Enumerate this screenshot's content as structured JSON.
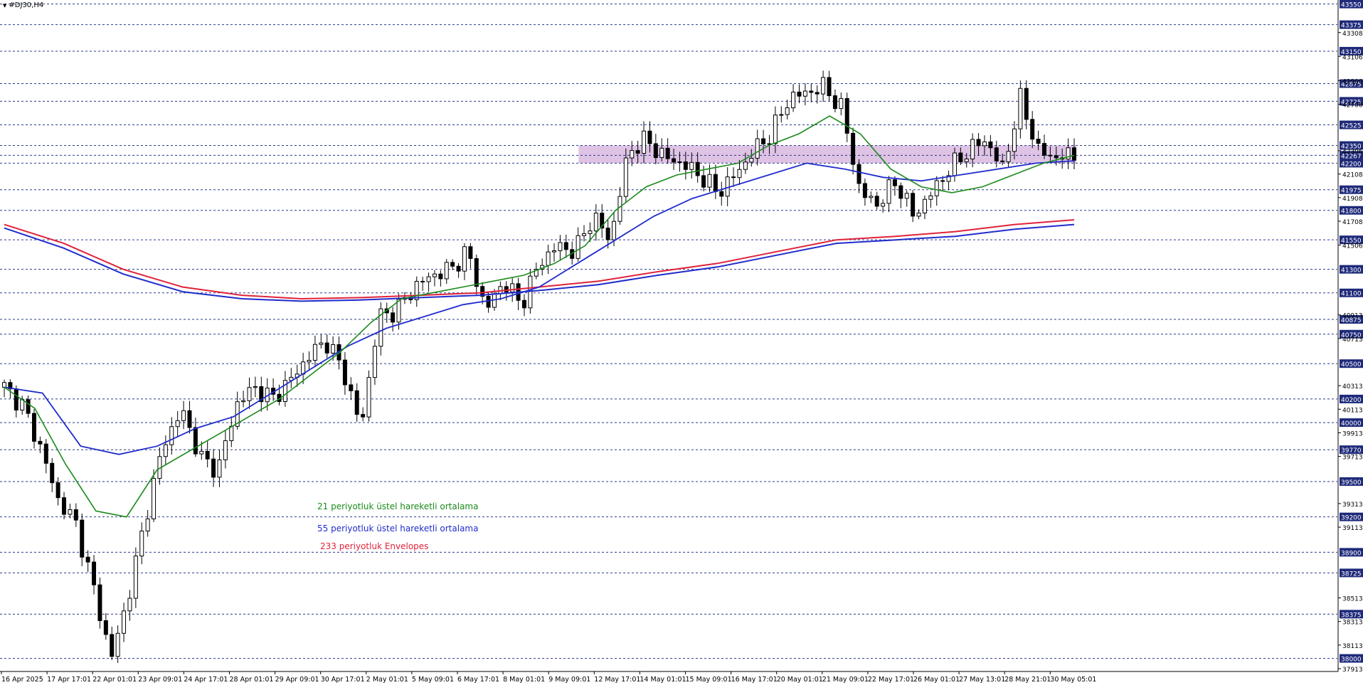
{
  "window": {
    "title": "#DJ30,H4",
    "menu_icon": "triangle-down-icon"
  },
  "colors": {
    "ema21": "#1a8a1a",
    "ema55": "#1f2ccc",
    "env_upper": "#e0233a",
    "env_lower": "#1f2ccc",
    "zone_fill": "#d9b8e0",
    "grid": "#2b3a8a",
    "candle_up": "#ffffff",
    "candle_down": "#000000",
    "price_tag_bg": "#1e2a7a",
    "price_tag_text": "#ffffff"
  },
  "annotations": [
    {
      "text": "21 periyotluk üstel hareketli ortalama",
      "color": "#1a8a1a"
    },
    {
      "text": "55 periyotluk üstel hareketli ortalama",
      "color": "#1f2ccc"
    },
    {
      "text": "233 periyotluk Envelopes",
      "color": "#e0233a"
    }
  ],
  "chart_data": {
    "type": "candlestick",
    "symbol": "#DJ30",
    "timeframe": "H4",
    "ylim": [
      37913,
      43560
    ],
    "grid": "horizontal-dashed",
    "highlighted_levels": [
      43550,
      43375,
      43150,
      42875,
      42725,
      42525,
      42350,
      42267,
      42200,
      41975,
      41800,
      41550,
      41300,
      41100,
      40875,
      40750,
      40500,
      40200,
      40000,
      39770,
      39500,
      39200,
      38900,
      38725,
      38375,
      38000
    ],
    "plain_ticks": [
      "43308",
      "43106",
      "42900",
      "42700",
      "42306",
      "42108",
      "41908",
      "41708",
      "41506",
      "40913",
      "40713",
      "40313",
      "40113",
      "39913",
      "39713",
      "39313",
      "39113",
      "38513",
      "38313",
      "38113",
      "37913"
    ],
    "x_labels": [
      "16 Apr 2025",
      "17 Apr 17:01",
      "22 Apr 01:01",
      "23 Apr 09:01",
      "24 Apr 17:01",
      "28 Apr 01:01",
      "29 Apr 09:01",
      "30 Apr 17:01",
      "2 May 01:01",
      "5 May 09:01",
      "6 May 17:01",
      "8 May 01:01",
      "9 May 09:01",
      "12 May 17:01",
      "14 May 01:01",
      "15 May 09:01",
      "16 May 17:01",
      "20 May 01:01",
      "21 May 09:01",
      "22 May 17:01",
      "26 May 01:01",
      "27 May 13:01",
      "28 May 21:01",
      "30 May 05:01"
    ],
    "resistance_zone": {
      "from": 42200,
      "to": 42350,
      "start_label": "12 May 17:01"
    },
    "close_points": [
      40300,
      40150,
      39800,
      39350,
      39150,
      38600,
      38000,
      38550,
      39250,
      39850,
      40100,
      39700,
      39600,
      40150,
      40300,
      40200,
      40350,
      40550,
      40700,
      40450,
      39950,
      40900,
      40950,
      41150,
      41250,
      41300,
      41450,
      40950,
      41200,
      41000,
      41350,
      41500,
      41450,
      41750,
      41550,
      42300,
      42400,
      42250,
      42200,
      42100,
      41950,
      42100,
      42300,
      42450,
      42750,
      42800,
      42850,
      42650,
      41950,
      41850,
      42050,
      41750,
      41950,
      42150,
      42300,
      42400,
      42150,
      42750,
      42300,
      42250,
      42270
    ],
    "series": [
      {
        "name": "21 periyotluk üstel hareketli ortalama",
        "type": "ema",
        "period": 21,
        "values": [
          40300,
          40120,
          39650,
          39250,
          39200,
          39600,
          39750,
          39900,
          40050,
          40200,
          40400,
          40600,
          40850,
          41050,
          41100,
          41150,
          41200,
          41250,
          41350,
          41500,
          41800,
          42000,
          42100,
          42150,
          42200,
          42350,
          42450,
          42600,
          42450,
          42150,
          42000,
          41950,
          42000,
          42100,
          42200,
          42267
        ]
      },
      {
        "name": "55 periyotluk üstel hareketli ortalama",
        "type": "ema",
        "period": 55,
        "values": [
          40300,
          40250,
          39800,
          39730,
          39800,
          39950,
          40050,
          40250,
          40450,
          40650,
          40800,
          40900,
          41000,
          41050,
          41150,
          41350,
          41550,
          41750,
          41900,
          42000,
          42100,
          42200,
          42150,
          42080,
          42050,
          42100,
          42150,
          42200,
          42220
        ]
      },
      {
        "name": "233 periyotluk Envelopes",
        "type": "envelope",
        "period": 233,
        "upper": [
          41680,
          41520,
          41300,
          41150,
          41080,
          41050,
          41060,
          41080,
          41100,
          41150,
          41200,
          41280,
          41350,
          41450,
          41550,
          41580,
          41620,
          41680,
          41720
        ],
        "lower": [
          41650,
          41480,
          41260,
          41110,
          41050,
          41030,
          41040,
          41060,
          41080,
          41120,
          41170,
          41250,
          41320,
          41420,
          41520,
          41550,
          41580,
          41640,
          41680
        ]
      }
    ]
  }
}
